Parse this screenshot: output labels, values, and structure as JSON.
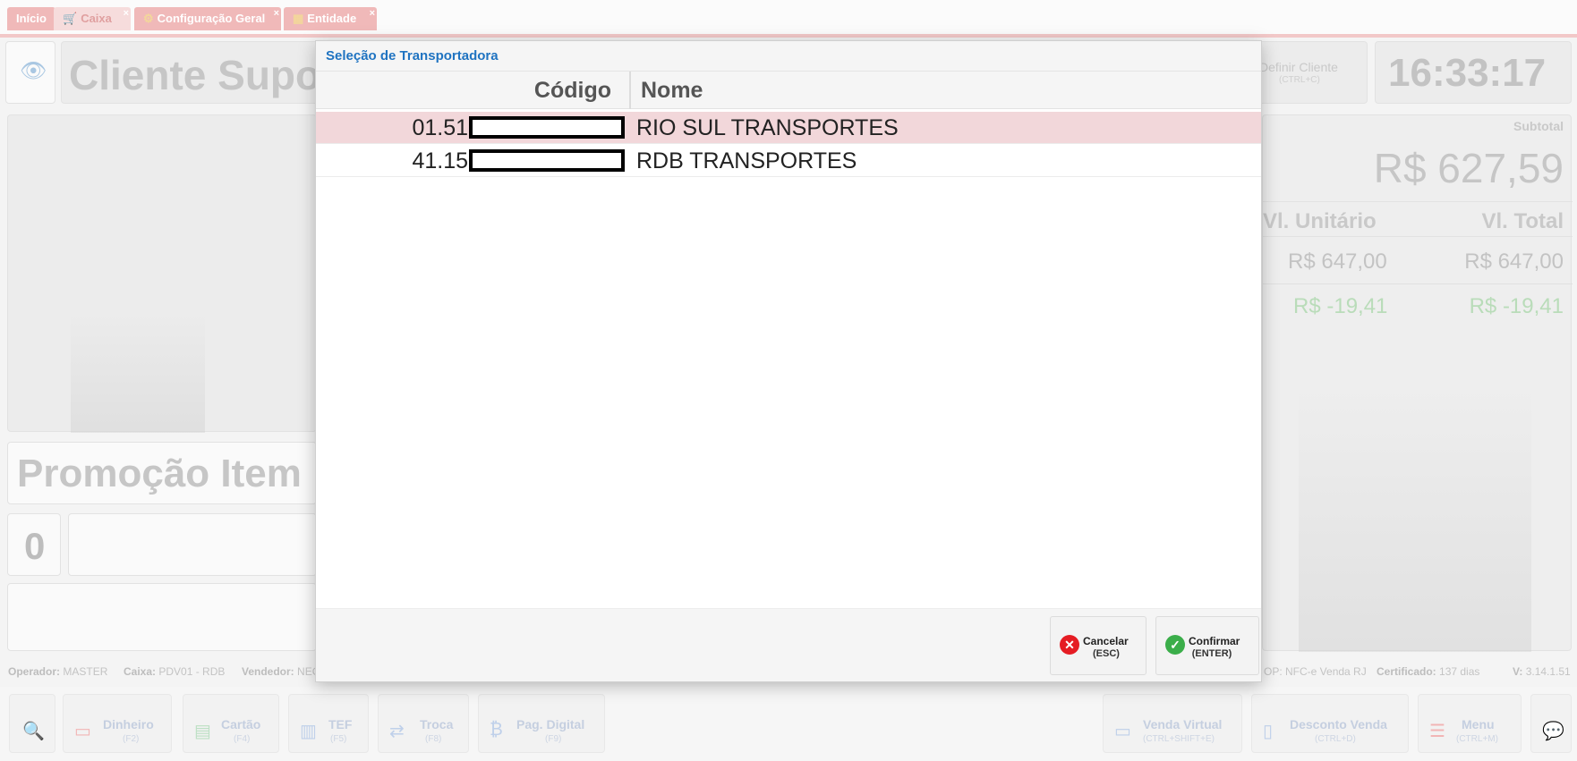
{
  "tabs": [
    {
      "label": "Início"
    },
    {
      "label": "Caixa"
    },
    {
      "label": "Configuração Geral"
    },
    {
      "label": "Entidade"
    }
  ],
  "background": {
    "client_name": "Cliente Supo",
    "define_client_label": "Definir Cliente",
    "define_client_key": "(CTRL+C)",
    "clock": "16:33:17",
    "subtotal_label": "Subtotal",
    "subtotal_value": "R$ 627,59",
    "col_unit": "Vl. Unitário",
    "col_total": "Vl. Total",
    "item_unit_price": "R$ 647,00",
    "item_total_price": "R$ 647,00",
    "discount_unit": "R$ -19,41",
    "discount_total": "R$ -19,41",
    "promo_title": "Promoção Item",
    "quantity": "0"
  },
  "status_bar": {
    "operador_label": "Operador:",
    "operador_value": "MASTER",
    "caixa_label": "Caixa:",
    "caixa_value": "PDV01 - RDB",
    "vendedor_label": "Vendedor:",
    "vendedor_value": "NEC",
    "op_text": "OP: NFC-e Venda RJ",
    "certificado_label": "Certificado:",
    "certificado_value": "137 dias",
    "version_label": "V:",
    "version_value": "3.14.1.51"
  },
  "bottom_buttons": {
    "dinheiro": {
      "label": "Dinheiro",
      "key": "(F2)"
    },
    "cartao": {
      "label": "Cartão",
      "key": "(F4)"
    },
    "tef": {
      "label": "TEF",
      "key": "(F5)"
    },
    "troca": {
      "label": "Troca",
      "key": "(F8)"
    },
    "pag_digital": {
      "label": "Pag. Digital",
      "key": "(F9)"
    },
    "venda_virtual": {
      "label": "Venda Virtual",
      "key": "(CTRL+SHIFT+E)"
    },
    "desconto_venda": {
      "label": "Desconto Venda",
      "key": "(CTRL+D)"
    },
    "menu": {
      "label": "Menu",
      "key": "(CTRL+M)"
    }
  },
  "modal": {
    "title": "Seleção de Transportadora",
    "columns": {
      "codigo": "Código",
      "nome": "Nome"
    },
    "rows": [
      {
        "code": "01.51",
        "name": "RIO SUL TRANSPORTES",
        "selected": true
      },
      {
        "code": "41.15",
        "name": "RDB TRANSPORTES",
        "selected": false
      }
    ],
    "cancel": {
      "label": "Cancelar",
      "key": "(ESC)"
    },
    "confirm": {
      "label": "Confirmar",
      "key": "(ENTER)"
    }
  }
}
